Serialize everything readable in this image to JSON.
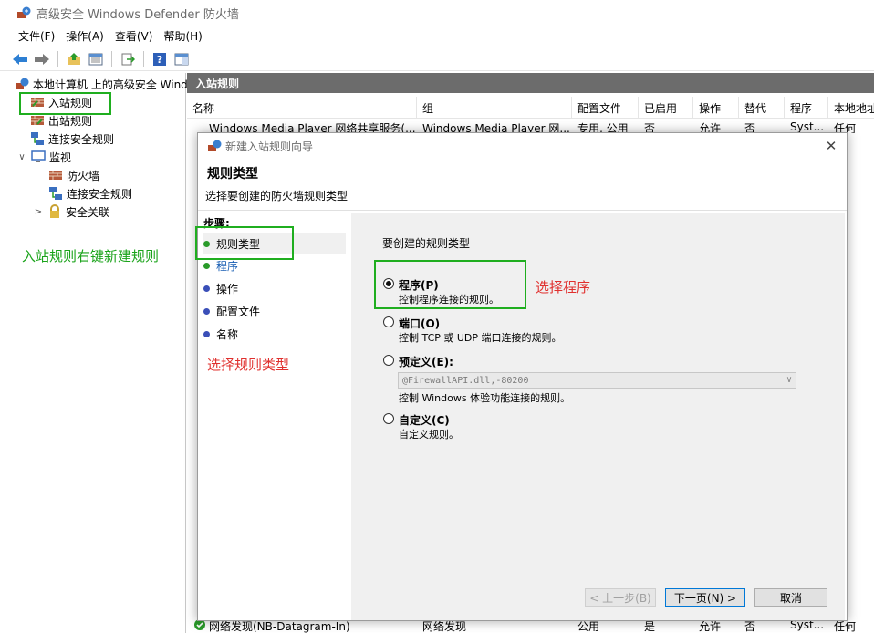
{
  "window": {
    "title": "高级安全 Windows Defender 防火墙"
  },
  "menu": [
    "文件(F)",
    "操作(A)",
    "查看(V)",
    "帮助(H)"
  ],
  "toolbar": [
    "back-icon",
    "forward-icon",
    "folder-up-icon",
    "show-hide-tree-icon",
    "export-icon",
    "help-icon",
    "show-action-pane-icon"
  ],
  "tree": {
    "root": "本地计算机 上的高级安全 Wind",
    "inbound": "入站规则",
    "outbound": "出站规则",
    "connection_security": "连接安全规则",
    "monitoring": "监视",
    "firewall": "防火墙",
    "monitor_connection_security": "连接安全规则",
    "security_associations": "安全关联"
  },
  "annotations": {
    "tree_note": "入站规则右键新建规则",
    "program_note": "选择程序",
    "step_note": "选择规则类型"
  },
  "content": {
    "header": "入站规则",
    "columns": [
      "名称",
      "组",
      "配置文件",
      "已启用",
      "操作",
      "替代",
      "程序",
      "本地地址"
    ],
    "top_row": {
      "name": "Windows Media Player 网络共享服务(...",
      "group": "Windows Media Player 网...",
      "profile": "专用, 公用",
      "enabled": "否",
      "action": "允许",
      "override": "否",
      "program": "Syst...",
      "local": "任何"
    },
    "side_values": [
      "何",
      "何",
      "何",
      "何",
      "何",
      "何",
      "何",
      "何",
      "何",
      "何",
      "何",
      "何",
      "何",
      "何",
      "何",
      "何",
      "何",
      "何",
      "何",
      "何",
      "何",
      "何",
      "何",
      "何",
      "何",
      "何"
    ],
    "bottom_row": {
      "name": "网络发现(NB-Datagram-In)",
      "group": "网络发现",
      "profile": "公用",
      "enabled": "是",
      "action": "允许",
      "override": "否",
      "program": "Syst...",
      "local": "任何"
    }
  },
  "dialog": {
    "title": "新建入站规则向导",
    "heading": "规则类型",
    "subtitle": "选择要创建的防火墙规则类型",
    "steps_title": "步骤:",
    "steps": [
      "规则类型",
      "程序",
      "操作",
      "配置文件",
      "名称"
    ],
    "prompt": "要创建的规则类型",
    "options": [
      {
        "label": "程序(P)",
        "desc": "控制程序连接的规则。",
        "checked": true
      },
      {
        "label": "端口(O)",
        "desc": "控制 TCP 或 UDP 端口连接的规则。",
        "checked": false
      },
      {
        "label": "预定义(E):",
        "desc": "控制 Windows 体验功能连接的规则。",
        "checked": false
      },
      {
        "label": "自定义(C)",
        "desc": "自定义规则。",
        "checked": false
      }
    ],
    "predefined_value": "@FirewallAPI.dll,-80200",
    "buttons": {
      "back": "< 上一步(B)",
      "next": "下一页(N) >",
      "cancel": "取消"
    }
  },
  "colors": {
    "annotation_green": "#1aa31a",
    "annotation_red": "#e0302e",
    "header_gray": "#6c6c6c"
  }
}
